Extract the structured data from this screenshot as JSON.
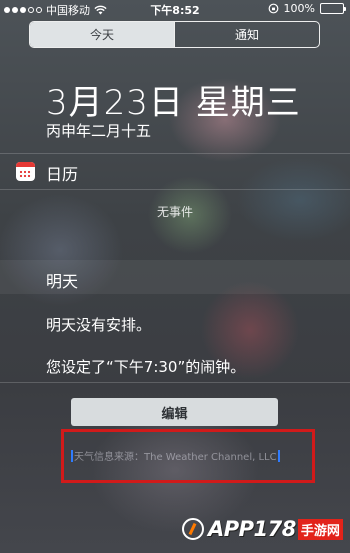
{
  "status_bar": {
    "carrier": "中国移动",
    "time": "下午8:52",
    "battery": "100%",
    "battery_level": 1.0
  },
  "tabs": [
    {
      "label": "今天",
      "selected": true
    },
    {
      "label": "通知",
      "selected": false
    }
  ],
  "today": {
    "date": "3月23日 星期三",
    "lunar_date": "丙申年二月十五"
  },
  "calendar_widget": {
    "title": "日历",
    "empty_text": "无事件"
  },
  "tomorrow": {
    "title": "明天",
    "no_plan": "明天没有安排。",
    "alarm": "您设定了“下午7:30”的闹钟。"
  },
  "edit_label": "编辑",
  "weather_source": "天气信息来源：The Weather Channel, LLC",
  "watermark": {
    "text": "APP178",
    "sub": "手游网"
  },
  "colors": {
    "highlight_border": "#d11a1a",
    "segment_active_bg": "#dfe3e5"
  }
}
